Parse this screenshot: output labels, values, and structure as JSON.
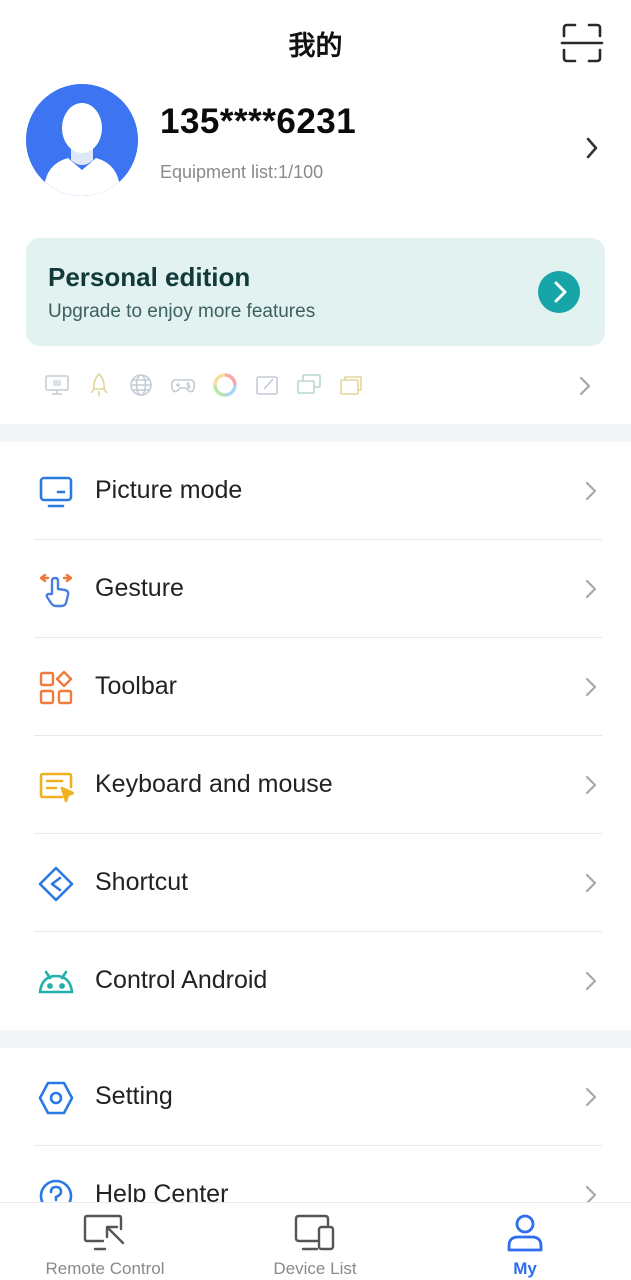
{
  "header": {
    "title": "我的"
  },
  "profile": {
    "phone": "135****6231",
    "equipment_list": "Equipment list:1/100"
  },
  "edition": {
    "title": "Personal edition",
    "subtitle": "Upgrade to enjoy more features"
  },
  "feature_icons": [
    "monitor-icon",
    "rocket-icon",
    "globe-icon",
    "gamepad-icon",
    "color-wheel-icon",
    "drawing-tablet-icon",
    "multi-screen-icon",
    "window-stack-icon"
  ],
  "menu": {
    "items": [
      {
        "label": "Picture mode",
        "icon": "monitor-icon",
        "color": "#2b79e3"
      },
      {
        "label": "Gesture",
        "icon": "gesture-hand-icon",
        "color": "#4a7fe0"
      },
      {
        "label": "Toolbar",
        "icon": "toolbar-grid-icon",
        "color": "#f07a3c"
      },
      {
        "label": "Keyboard and mouse",
        "icon": "keyboard-mouse-icon",
        "color": "#f0b020"
      },
      {
        "label": "Shortcut",
        "icon": "shortcut-icon",
        "color": "#2b79e3"
      },
      {
        "label": "Control Android",
        "icon": "android-icon",
        "color": "#22b0a8"
      }
    ]
  },
  "menu2": {
    "items": [
      {
        "label": "Setting",
        "icon": "settings-hexagon-icon",
        "color": "#2b79e3"
      },
      {
        "label": "Help Center",
        "icon": "help-icon",
        "color": "#2b79e3"
      }
    ]
  },
  "tabbar": {
    "tabs": [
      {
        "label": "Remote Control",
        "icon": "remote-control-icon",
        "active": false
      },
      {
        "label": "Device List",
        "icon": "device-list-icon",
        "active": false
      },
      {
        "label": "My",
        "icon": "user-icon",
        "active": true
      }
    ]
  },
  "colors": {
    "accent": "#2f6df0",
    "edition_bg": "#e1f2f1",
    "edition_button": "#17a5a8",
    "avatar_bg": "#3d74f2"
  }
}
